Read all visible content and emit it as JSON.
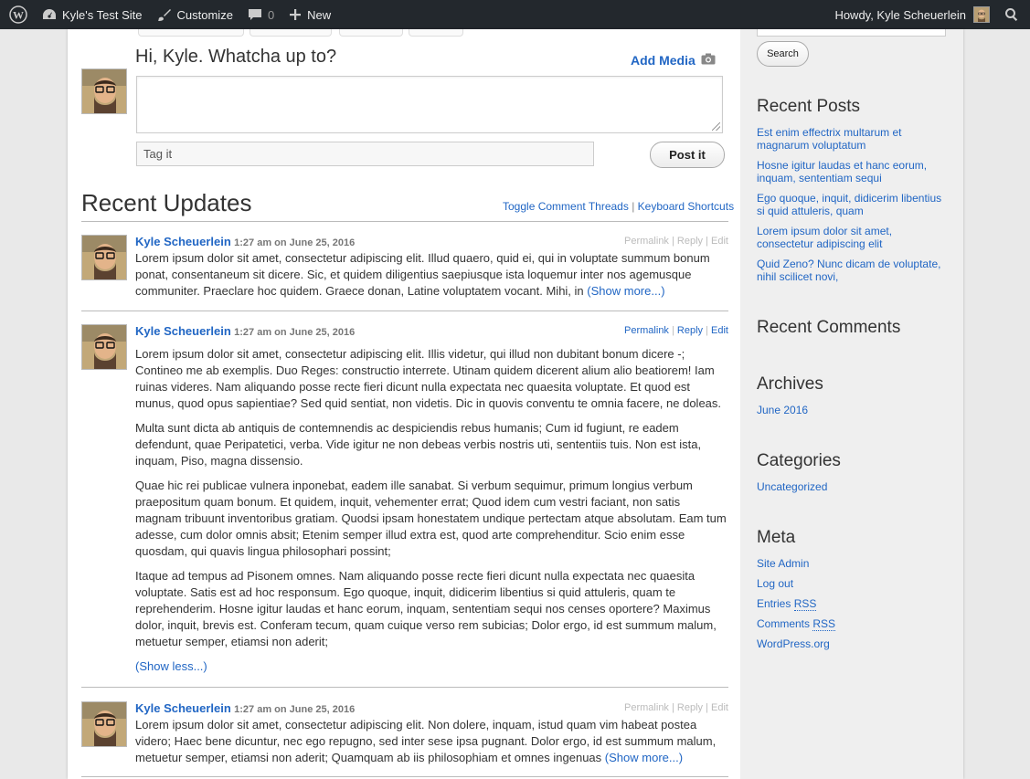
{
  "admin_bar": {
    "site_name": "Kyle's Test Site",
    "customize": "Customize",
    "comments_count": "0",
    "new_label": "New",
    "howdy": "Howdy, Kyle Scheuerlein"
  },
  "postbox": {
    "greeting": "Hi, Kyle. Whatcha up to?",
    "add_media": "Add Media",
    "textarea_value": "",
    "tag_placeholder": "Tag it",
    "post_button": "Post it"
  },
  "updates": {
    "title": "Recent Updates",
    "toggle_threads": "Toggle Comment Threads",
    "separator": "|",
    "keyboard_shortcuts": "Keyboard Shortcuts"
  },
  "posts": [
    {
      "author": "Kyle Scheuerlein",
      "date": "1:27 am on June 25, 2016",
      "actions": {
        "permalink": "Permalink",
        "reply": "Reply",
        "edit": "Edit",
        "sep": "|"
      },
      "paragraphs": [
        "Lorem ipsum dolor sit amet, consectetur adipiscing elit. Illud quaero, quid ei, qui in voluptate summum bonum ponat, consentaneum sit dicere. Sic, et quidem diligentius saepiusque ista loquemur inter nos agemusque communiter. Praeclare hoc quidem. Graece donan, Latine voluptatem vocant. Mihi, in"
      ],
      "toggle": "(Show more...)"
    },
    {
      "author": "Kyle Scheuerlein",
      "date": "1:27 am on June 25, 2016",
      "actions": {
        "permalink": "Permalink",
        "reply": "Reply",
        "edit": "Edit",
        "sep": "|"
      },
      "paragraphs": [
        "Lorem ipsum dolor sit amet, consectetur adipiscing elit. Illis videtur, qui illud non dubitant bonum dicere -; Contineo me ab exemplis. Duo Reges: constructio interrete. Utinam quidem dicerent alium alio beatiorem! Iam ruinas videres. Nam aliquando posse recte fieri dicunt nulla expectata nec quaesita voluptate. Et quod est munus, quod opus sapientiae? Sed quid sentiat, non videtis. Dic in quovis conventu te omnia facere, ne doleas.",
        "Multa sunt dicta ab antiquis de contemnendis ac despiciendis rebus humanis; Cum id fugiunt, re eadem defendunt, quae Peripatetici, verba. Vide igitur ne non debeas verbis nostris uti, sententiis tuis. Non est ista, inquam, Piso, magna dissensio.",
        "Quae hic rei publicae vulnera inponebat, eadem ille sanabat. Si verbum sequimur, primum longius verbum praepositum quam bonum. Et quidem, inquit, vehementer errat; Quod idem cum vestri faciant, non satis magnam tribuunt inventoribus gratiam. Quodsi ipsam honestatem undique pertectam atque absolutam. Eam tum adesse, cum dolor omnis absit; Etenim semper illud extra est, quod arte comprehenditur. Scio enim esse quosdam, qui quavis lingua philosophari possint;",
        "Itaque ad tempus ad Pisonem omnes. Nam aliquando posse recte fieri dicunt nulla expectata nec quaesita voluptate. Satis est ad hoc responsum. Ego quoque, inquit, didicerim libentius si quid attuleris, quam te reprehenderim. Hosne igitur laudas et hanc eorum, inquam, sententiam sequi nos censes oportere? Maximus dolor, inquit, brevis est. Conferam tecum, quam cuique verso rem subicias; Dolor ergo, id est summum malum, metuetur semper, etiamsi non aderit;"
      ],
      "toggle": "(Show less...)"
    },
    {
      "author": "Kyle Scheuerlein",
      "date": "1:27 am on June 25, 2016",
      "actions": {
        "permalink": "Permalink",
        "reply": "Reply",
        "edit": "Edit",
        "sep": "|"
      },
      "paragraphs": [
        "Lorem ipsum dolor sit amet, consectetur adipiscing elit. Non dolere, inquam, istud quam vim habeat postea videro; Haec bene dicuntur, nec ego repugno, sed inter sese ipsa pugnant. Dolor ergo, id est summum malum, metuetur semper, etiamsi non aderit; Quamquam ab iis philosophiam et omnes ingenuas"
      ],
      "toggle": "(Show more...)"
    }
  ],
  "sidebar": {
    "search_button": "Search",
    "recent_posts_title": "Recent Posts",
    "recent_posts": [
      "Est enim effectrix multarum et magnarum voluptatum",
      "Hosne igitur laudas et hanc eorum, inquam, sententiam sequi",
      "Ego quoque, inquit, didicerim libentius si quid attuleris, quam",
      "Lorem ipsum dolor sit amet, consectetur adipiscing elit",
      "Quid Zeno? Nunc dicam de voluptate, nihil scilicet novi,"
    ],
    "recent_comments_title": "Recent Comments",
    "archives_title": "Archives",
    "archives": [
      "June 2016"
    ],
    "categories_title": "Categories",
    "categories": [
      "Uncategorized"
    ],
    "meta_title": "Meta",
    "meta": {
      "site_admin": "Site Admin",
      "log_out": "Log out",
      "entries": "Entries",
      "comments": "Comments",
      "rss": "RSS",
      "wordpress": "WordPress.org"
    }
  },
  "colors": {
    "link": "#2166c4",
    "admin_bar": "#23282d"
  }
}
